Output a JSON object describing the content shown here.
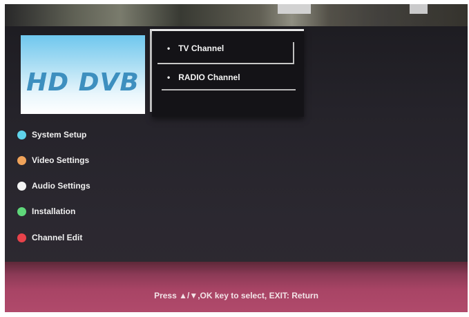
{
  "logo": {
    "text": "HD DVB"
  },
  "submenu": {
    "items": [
      {
        "bullet": "•",
        "label": "TV Channel"
      },
      {
        "bullet": "•",
        "label": "RADIO Channel"
      }
    ]
  },
  "menu": {
    "items": [
      {
        "label": "System Setup",
        "color": "#5fd3ea"
      },
      {
        "label": "Video Settings",
        "color": "#f0a35a"
      },
      {
        "label": "Audio Settings",
        "color": "#f4f4f4"
      },
      {
        "label": "Installation",
        "color": "#5fd77a"
      },
      {
        "label": "Channel Edit",
        "color": "#e8424a"
      }
    ]
  },
  "footer": {
    "hint": "Press ▲/▼,OK key to select, EXIT: Return"
  }
}
